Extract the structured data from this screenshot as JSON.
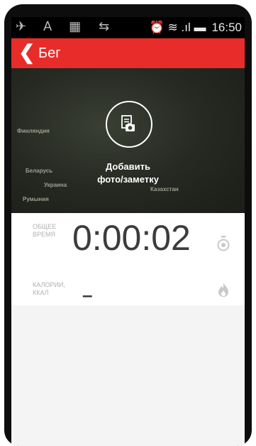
{
  "statusbar": {
    "left_icons": "✈ A ▦ ⇆",
    "right_icons": "⏰ ≋ .ıl ▬",
    "time": "16:50"
  },
  "toolbar": {
    "back_icon": "chevron-left-icon",
    "title": "Бег",
    "background": "#e82c2a"
  },
  "media": {
    "map_labels": [
      "Финляндия",
      "Беларусь",
      "Украина",
      "Румыния",
      "Казахстан"
    ],
    "photo_label_line1": "Добавить",
    "photo_label_line2": "фото/заметку"
  },
  "stats": {
    "time_label_line1": "ОБЩЕЕ",
    "time_label_line2": "ВРЕМЯ",
    "time_value": "0:00:02",
    "calories_label_line1": "КАЛОРИИ,",
    "calories_label_line2": "ККАЛ",
    "calories_value": "–"
  }
}
